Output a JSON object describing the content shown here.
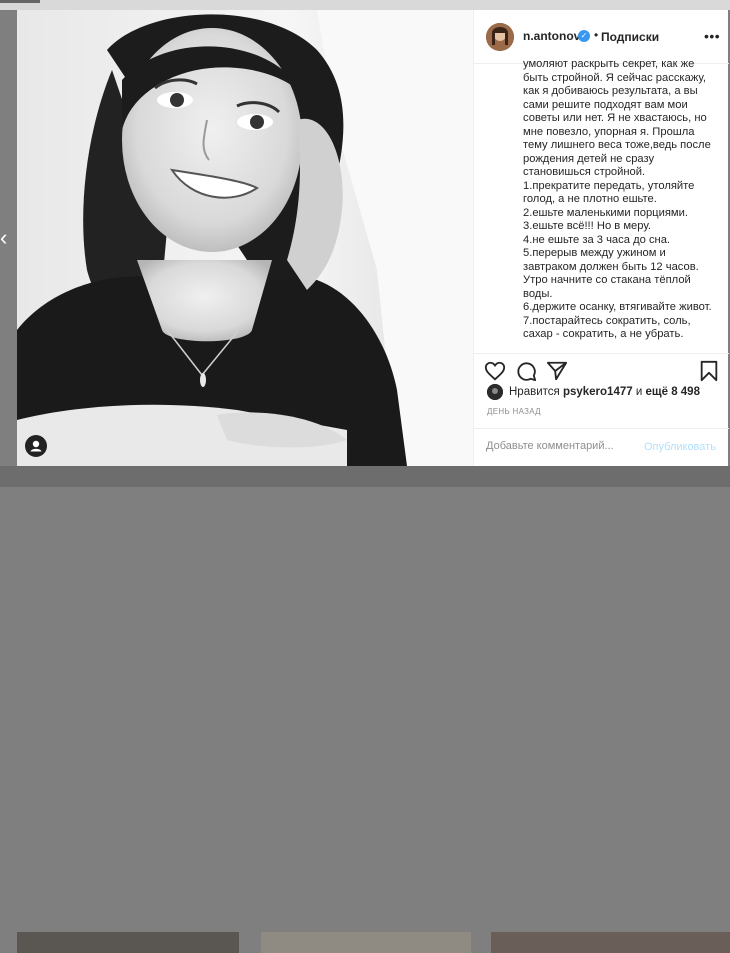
{
  "post": {
    "username": "n.antonova",
    "follow_separator": "•",
    "follow_label": "Подписки",
    "more_label": "•••",
    "caption_lines": [
      "умоляют раскрыть секрет, как же",
      "быть стройной. Я сейчас расскажу,",
      "как я добиваюсь результата, а вы",
      "сами решите подходят вам мои",
      "советы или нет. Я не хвастаюсь, но",
      "мне повезло, упорная я. Прошла",
      "тему лишнего веса тоже,ведь после",
      "рождения детей не сразу",
      "становишься стройной.",
      "1.прекратите передать, утоляйте",
      "голод, а не плотно ешьте.",
      "2.ешьте маленькими порциями.",
      "3.ешьте всё!!! Но в меру.",
      "4.не ешьте за 3 часа до сна.",
      "5.перерыв между ужином и",
      "завтраком должен быть 12 часов.",
      "Утро начните со стакана тёплой",
      "воды.",
      "6.держите осанку, втягивайте живот.",
      "7.постарайтесь сократить, соль,",
      "сахар - сократить, а не убрать."
    ],
    "likes": {
      "prefix": "Нравится",
      "user": "psykero1477",
      "middle": "и",
      "others": "ещё 8 498"
    },
    "date": "ДЕНЬ НАЗАД",
    "comment_placeholder": "Добавьте комментарий...",
    "publish_label": "Опубликовать"
  },
  "nav": {
    "prev_glyph": "‹"
  },
  "colors": {
    "verified": "#3897f0",
    "publish_disabled": "#b2dffc",
    "text": "#262626",
    "muted": "#8e8e8e"
  },
  "icons": [
    "chevron-left-icon",
    "verified-badge-icon",
    "more-icon",
    "heart-icon",
    "comment-icon",
    "share-icon",
    "bookmark-icon",
    "user-tag-icon"
  ]
}
